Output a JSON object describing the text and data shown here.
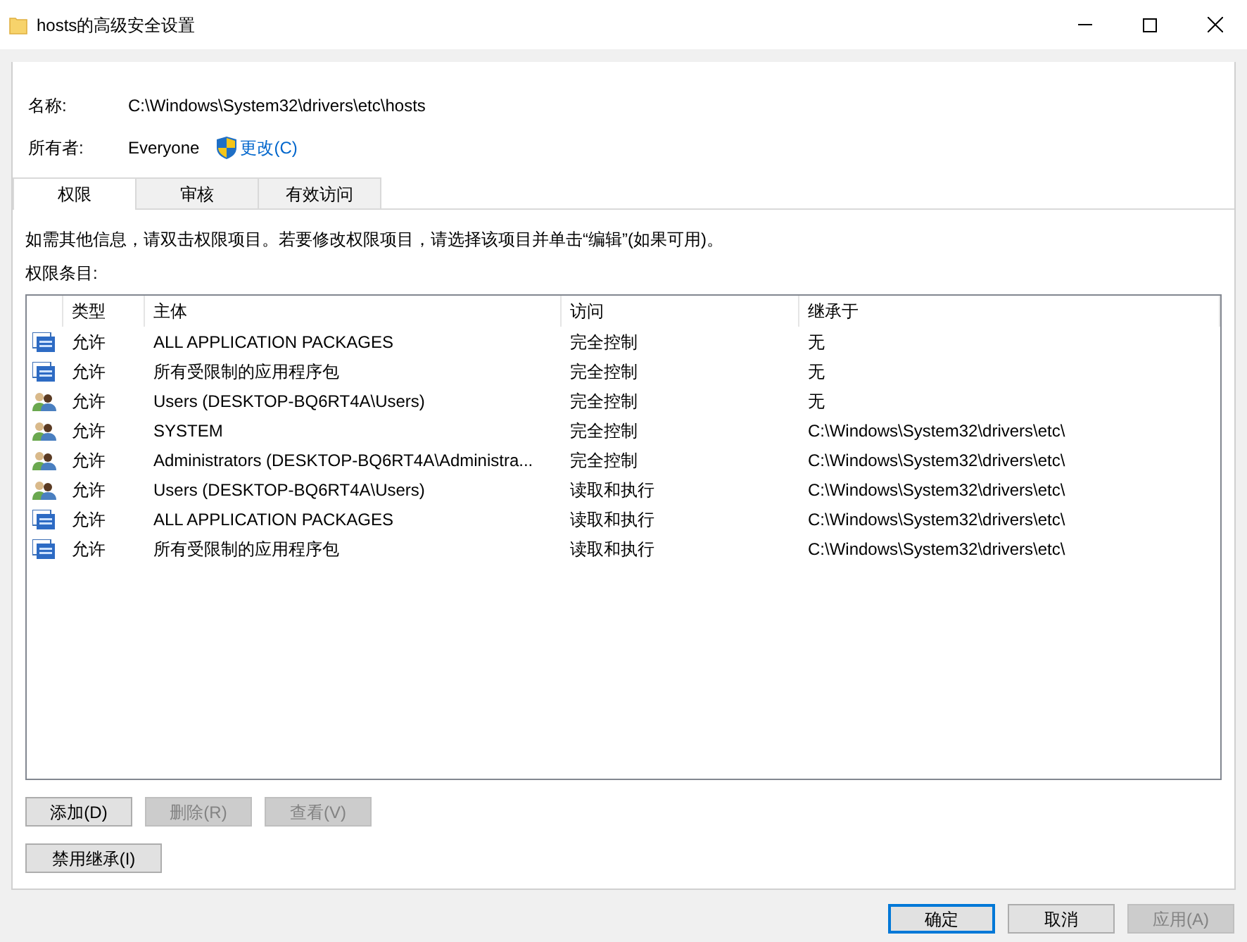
{
  "window": {
    "title": "hosts的高级安全设置"
  },
  "name": {
    "label": "名称:",
    "value": "C:\\Windows\\System32\\drivers\\etc\\hosts"
  },
  "owner": {
    "label": "所有者:",
    "value": "Everyone",
    "link": "更改(C)"
  },
  "tabs": [
    {
      "label": "权限",
      "selected": true
    },
    {
      "label": "审核",
      "selected": false
    },
    {
      "label": "有效访问",
      "selected": false
    }
  ],
  "instruction": "如需其他信息，请双击权限项目。若要修改权限项目，请选择该项目并单击“编辑”(如果可用)。",
  "list_label": "权限条目:",
  "table": {
    "columns": [
      "类型",
      "主体",
      "访问",
      "继承于"
    ],
    "rows": [
      {
        "kind": "app",
        "cells": [
          "允许",
          "ALL APPLICATION PACKAGES",
          "完全控制",
          "无"
        ]
      },
      {
        "kind": "app",
        "cells": [
          "允许",
          "所有受限制的应用程序包",
          "完全控制",
          "无"
        ]
      },
      {
        "kind": "user",
        "cells": [
          "允许",
          "Users (DESKTOP-BQ6RT4A\\Users)",
          "完全控制",
          "无"
        ]
      },
      {
        "kind": "user",
        "cells": [
          "允许",
          "SYSTEM",
          "完全控制",
          "C:\\Windows\\System32\\drivers\\etc\\"
        ]
      },
      {
        "kind": "user",
        "cells": [
          "允许",
          "Administrators (DESKTOP-BQ6RT4A\\Administra...",
          "完全控制",
          "C:\\Windows\\System32\\drivers\\etc\\"
        ]
      },
      {
        "kind": "user",
        "cells": [
          "允许",
          "Users (DESKTOP-BQ6RT4A\\Users)",
          "读取和执行",
          "C:\\Windows\\System32\\drivers\\etc\\"
        ]
      },
      {
        "kind": "app",
        "cells": [
          "允许",
          "ALL APPLICATION PACKAGES",
          "读取和执行",
          "C:\\Windows\\System32\\drivers\\etc\\"
        ]
      },
      {
        "kind": "app",
        "cells": [
          "允许",
          "所有受限制的应用程序包",
          "读取和执行",
          "C:\\Windows\\System32\\drivers\\etc\\"
        ]
      }
    ]
  },
  "list_buttons": [
    {
      "label": "添加(D)",
      "disabled": false
    },
    {
      "label": "删除(R)",
      "disabled": true
    },
    {
      "label": "查看(V)",
      "disabled": true
    }
  ],
  "inherit_button": {
    "label": "禁用继承(I)",
    "disabled": false
  },
  "dialog_buttons": [
    {
      "label": "确定",
      "disabled": false,
      "default": true
    },
    {
      "label": "取消",
      "disabled": false,
      "default": false
    },
    {
      "label": "应用(A)",
      "disabled": true,
      "default": false
    }
  ]
}
